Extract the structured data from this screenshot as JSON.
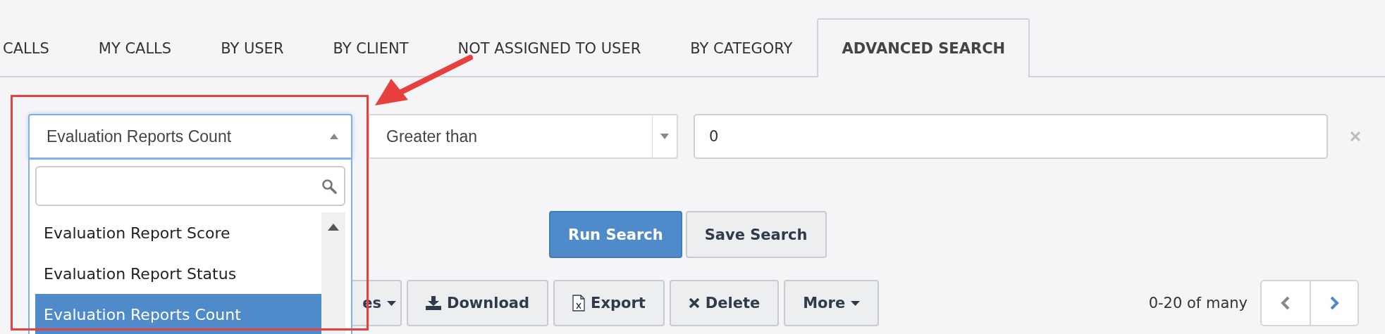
{
  "tabs": [
    {
      "label": "CALLS",
      "selected": false
    },
    {
      "label": "MY CALLS",
      "selected": false
    },
    {
      "label": "BY USER",
      "selected": false
    },
    {
      "label": "BY CLIENT",
      "selected": false
    },
    {
      "label": "NOT ASSIGNED TO USER",
      "selected": false
    },
    {
      "label": "BY CATEGORY",
      "selected": false
    },
    {
      "label": "ADVANCED SEARCH",
      "selected": true
    }
  ],
  "filter": {
    "field_select": {
      "value": "Evaluation Reports Count",
      "expanded": true
    },
    "dropdown": {
      "options": [
        {
          "label": "Evaluation Report Score",
          "selected": false
        },
        {
          "label": "Evaluation Report Status",
          "selected": false
        },
        {
          "label": "Evaluation Reports Count",
          "selected": true
        }
      ]
    },
    "operator_select": {
      "value": "Greater than"
    },
    "value_field": {
      "value": "0"
    }
  },
  "search_buttons": [
    {
      "label": "Run Search",
      "kind": "primary"
    },
    {
      "label": "Save Search",
      "kind": "default"
    }
  ],
  "toolbar": [
    {
      "label": "es",
      "kind": "dropdown"
    },
    {
      "label": "Download",
      "kind": "download"
    },
    {
      "label": "Export",
      "kind": "export"
    },
    {
      "label": "Delete",
      "kind": "delete"
    },
    {
      "label": "More",
      "kind": "dropdown"
    }
  ],
  "pagination": {
    "range": "0-20 of many",
    "previous": {
      "disabled": true
    },
    "next": {
      "disabled": false
    }
  }
}
